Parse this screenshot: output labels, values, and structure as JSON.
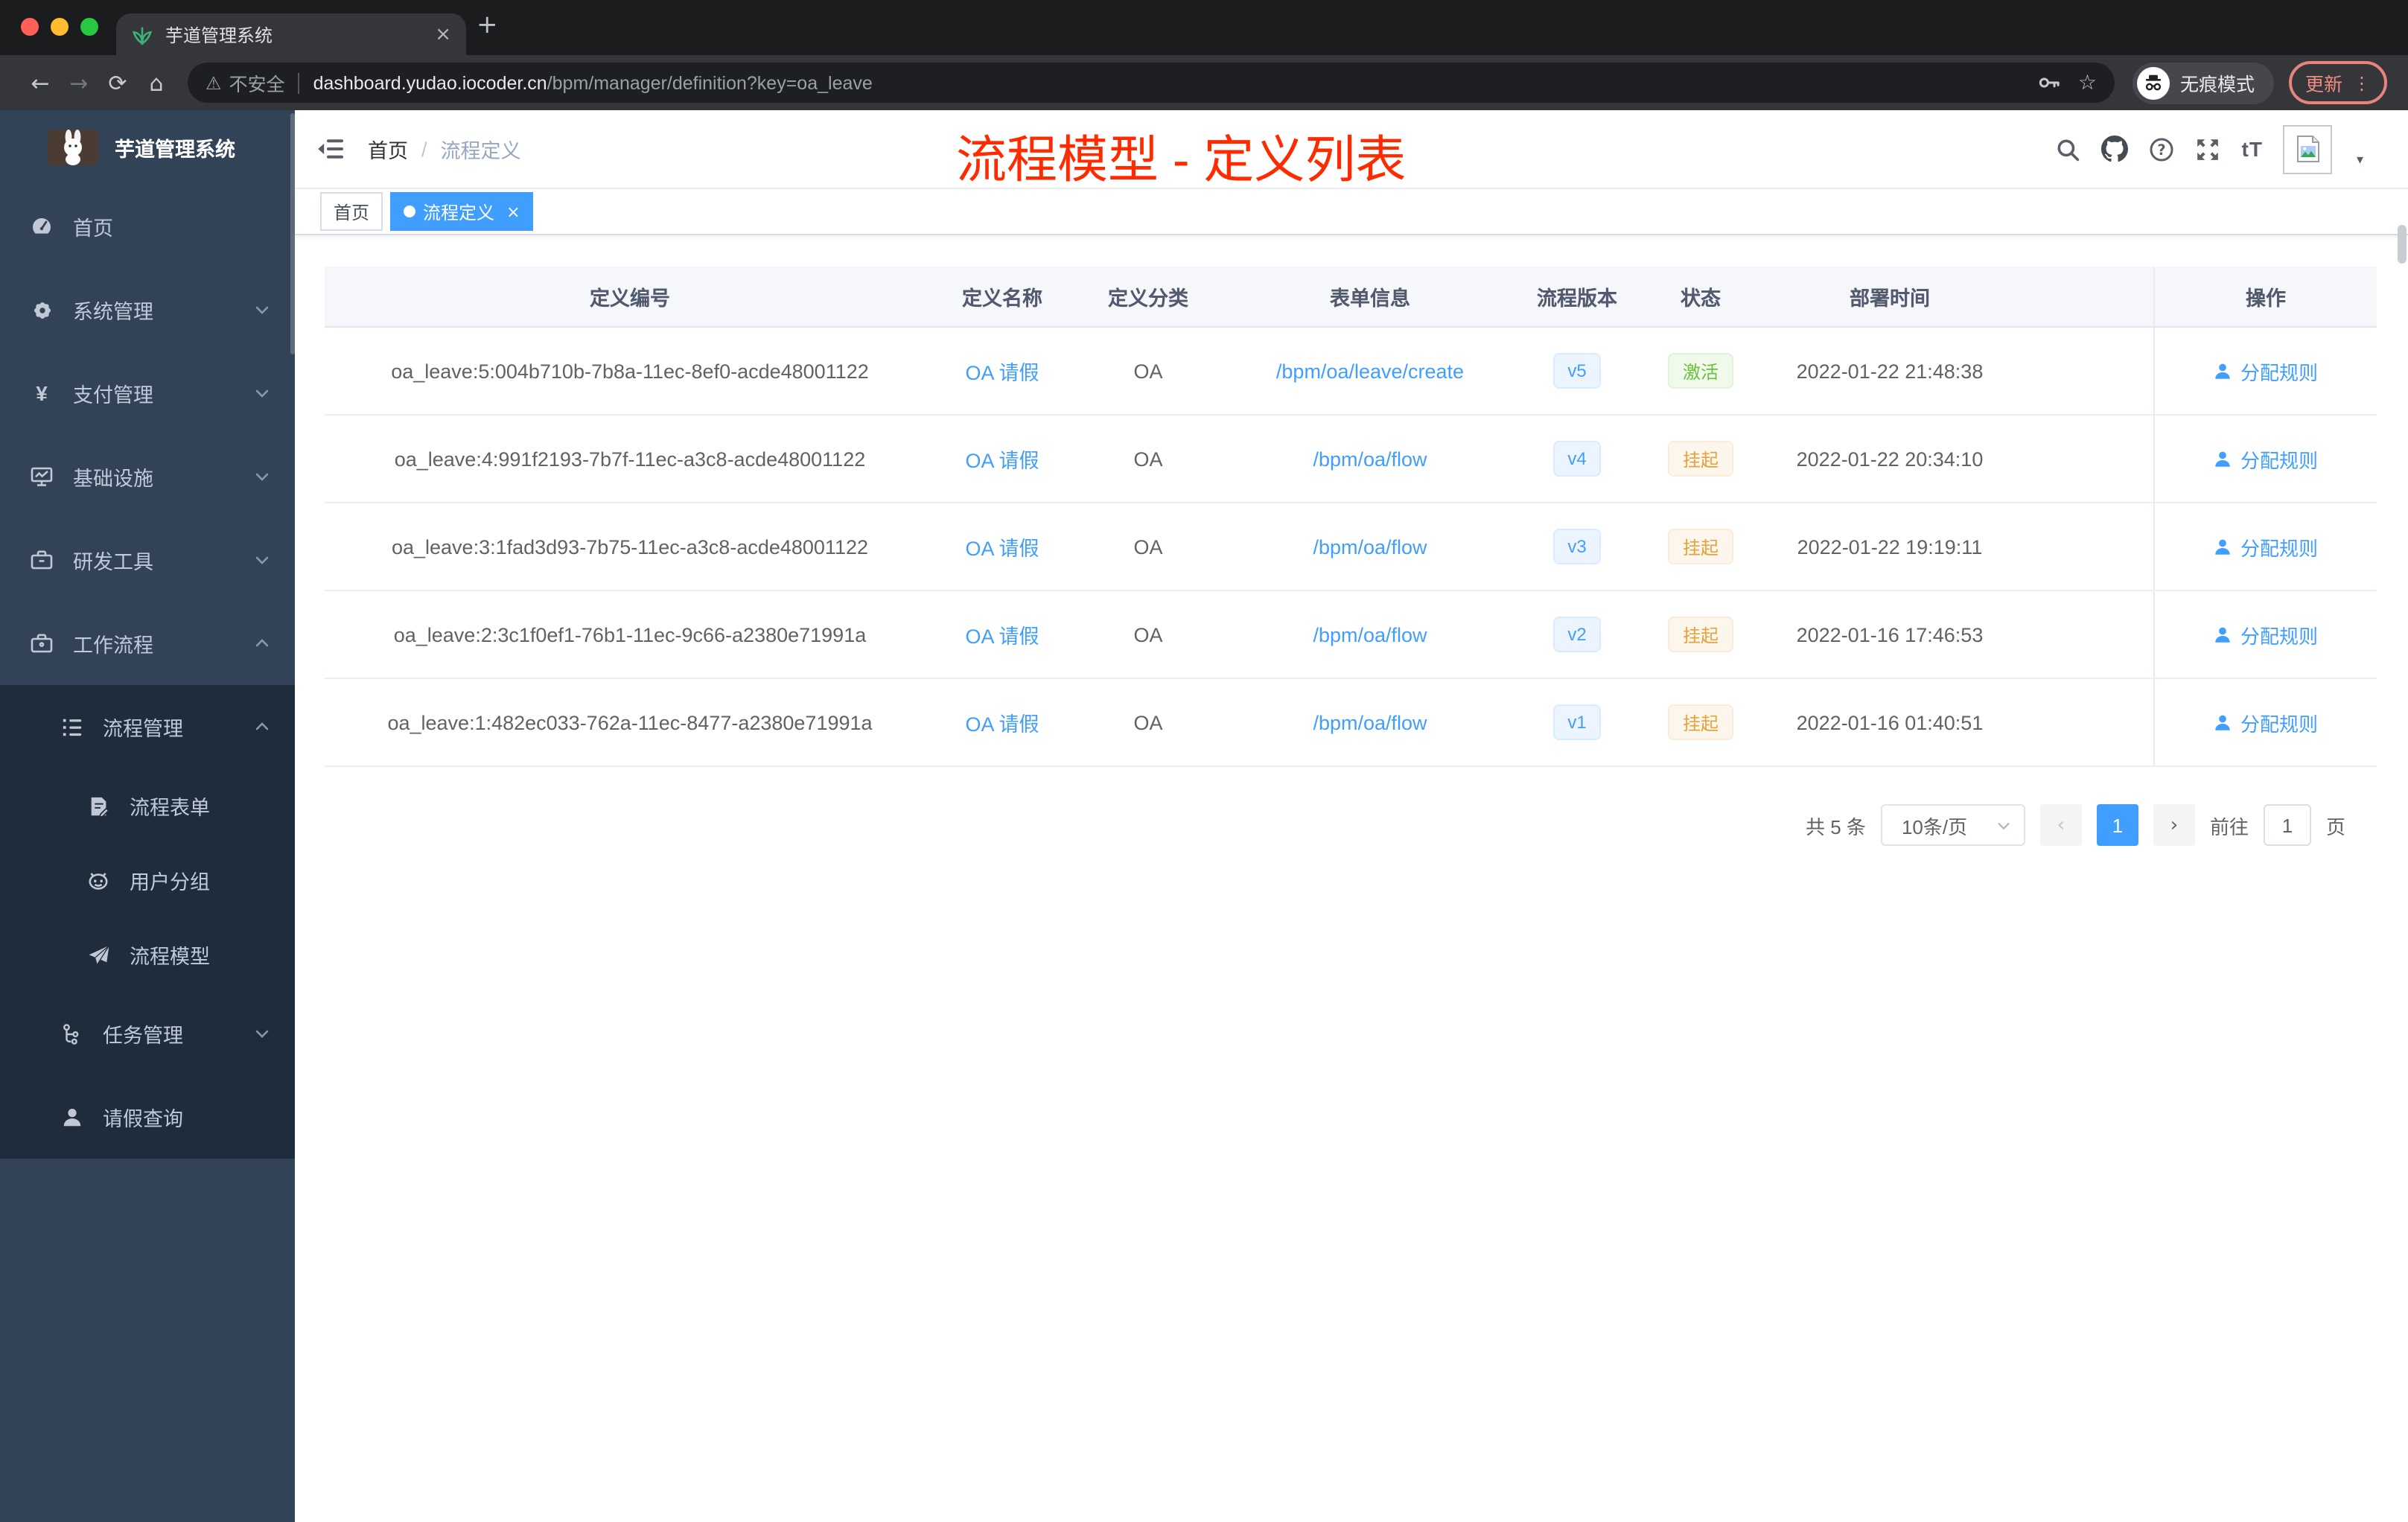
{
  "browser": {
    "tab": {
      "title": "芋道管理系统",
      "close_icon": "×"
    },
    "new_tab_icon": "+",
    "nav": {
      "back": "←",
      "forward": "→",
      "reload": "⟳",
      "home": "⌂"
    },
    "omnibox": {
      "warning_icon": "⚠",
      "security_label": "不安全",
      "domain": "dashboard.yudao.iocoder.cn",
      "path": "/bpm/manager/definition?key=oa_leave",
      "star_icon": "☆"
    },
    "incognito_label": "无痕模式",
    "update_button": {
      "label": "更新",
      "menu_icon": "⋮"
    }
  },
  "sidebar": {
    "logo_title": "芋道管理系统",
    "menu": [
      {
        "label": "首页",
        "icon": "dashboard-icon"
      },
      {
        "label": "系统管理",
        "icon": "gear-icon",
        "chevron": "down"
      },
      {
        "label": "支付管理",
        "icon": "yen-icon",
        "chevron": "down"
      },
      {
        "label": "基础设施",
        "icon": "monitor-icon",
        "chevron": "down"
      },
      {
        "label": "研发工具",
        "icon": "toolbox-icon",
        "chevron": "down"
      },
      {
        "label": "工作流程",
        "icon": "briefcase-icon",
        "chevron": "up"
      },
      {
        "label": "流程管理",
        "icon": "tree-list-icon",
        "chevron": "up"
      },
      {
        "label": "流程表单",
        "icon": "form-icon"
      },
      {
        "label": "用户分组",
        "icon": "robot-icon"
      },
      {
        "label": "流程模型",
        "icon": "paper-plane-icon"
      },
      {
        "label": "任务管理",
        "icon": "flow-icon",
        "chevron": "down"
      },
      {
        "label": "请假查询",
        "icon": "user-icon"
      }
    ]
  },
  "header": {
    "breadcrumb": {
      "home": "首页",
      "separator": "/",
      "current": "流程定义"
    },
    "annotation": "流程模型 - 定义列表"
  },
  "tags": [
    {
      "label": "首页"
    },
    {
      "label": "流程定义",
      "close": "×"
    }
  ],
  "table": {
    "columns": [
      "定义编号",
      "定义名称",
      "定义分类",
      "表单信息",
      "流程版本",
      "状态",
      "部署时间",
      "操作"
    ],
    "rows": [
      {
        "id": "oa_leave:5:004b710b-7b8a-11ec-8ef0-acde48001122",
        "name": "OA 请假",
        "category": "OA",
        "form": "/bpm/oa/leave/create",
        "version": "v5",
        "status": "激活",
        "time": "2022-01-22 21:48:38",
        "action": "分配规则"
      },
      {
        "id": "oa_leave:4:991f2193-7b7f-11ec-a3c8-acde48001122",
        "name": "OA 请假",
        "category": "OA",
        "form": "/bpm/oa/flow",
        "version": "v4",
        "status": "挂起",
        "time": "2022-01-22 20:34:10",
        "action": "分配规则"
      },
      {
        "id": "oa_leave:3:1fad3d93-7b75-11ec-a3c8-acde48001122",
        "name": "OA 请假",
        "category": "OA",
        "form": "/bpm/oa/flow",
        "version": "v3",
        "status": "挂起",
        "time": "2022-01-22 19:19:11",
        "action": "分配规则"
      },
      {
        "id": "oa_leave:2:3c1f0ef1-76b1-11ec-9c66-a2380e71991a",
        "name": "OA 请假",
        "category": "OA",
        "form": "/bpm/oa/flow",
        "version": "v2",
        "status": "挂起",
        "time": "2022-01-16 17:46:53",
        "action": "分配规则"
      },
      {
        "id": "oa_leave:1:482ec033-762a-11ec-8477-a2380e71991a",
        "name": "OA 请假",
        "category": "OA",
        "form": "/bpm/oa/flow",
        "version": "v1",
        "status": "挂起",
        "time": "2022-01-16 01:40:51",
        "action": "分配规则"
      }
    ]
  },
  "pagination": {
    "total": "共 5 条",
    "page_size": "10条/页",
    "prev": "‹",
    "current_page": "1",
    "next": "›",
    "goto_label": "前往",
    "goto_value": "1",
    "unit": "页"
  },
  "colors": {
    "accent": "#409eff",
    "success": "#67c23a",
    "warning": "#e6a23c",
    "annotation_red": "#ff2b00",
    "sidebar_bg": "#324358",
    "submenu_bg": "#1e2c3c"
  }
}
